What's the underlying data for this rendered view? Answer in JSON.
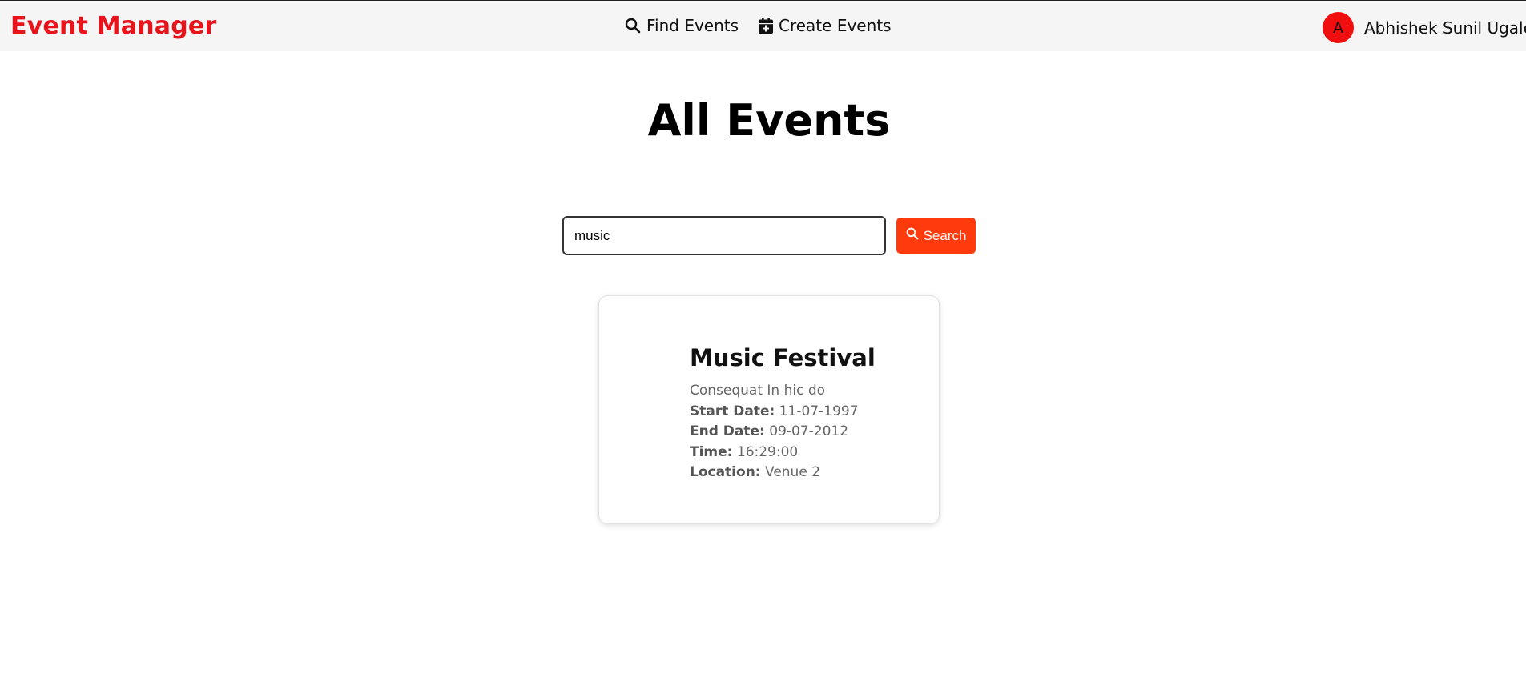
{
  "app": {
    "brand": "Event Manager"
  },
  "nav": {
    "find_label": "Find Events",
    "create_label": "Create Events"
  },
  "user": {
    "initial": "A",
    "name": "Abhishek Sunil Ugale"
  },
  "page": {
    "title": "All Events"
  },
  "search": {
    "value": "music",
    "button_label": "Search"
  },
  "events": [
    {
      "title": "Music Festival",
      "description": "Consequat In hic do",
      "start_date_label": "Start Date:",
      "start_date": "11-07-1997",
      "end_date_label": "End Date:",
      "end_date": "09-07-2012",
      "time_label": "Time:",
      "time": "16:29:00",
      "location_label": "Location:",
      "location": "Venue 2"
    }
  ],
  "colors": {
    "brand": "#e8141c",
    "accent": "#ff3a0c",
    "avatar": "#f00e0e",
    "topbar_bg": "#f5f5f5"
  },
  "icons": {
    "find": "search-icon",
    "create": "calendar-plus-icon",
    "user_menu": "caret-down-icon",
    "search_button": "search-icon"
  }
}
